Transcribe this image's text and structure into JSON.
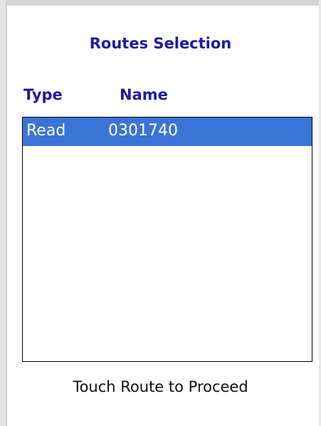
{
  "screen": {
    "title": "Routes Selection",
    "footer_text": "Touch Route to Proceed"
  },
  "routes_list": {
    "columns": [
      "Type",
      "Name"
    ],
    "rows": [
      {
        "type": "Read",
        "name": "0301740",
        "selected": true
      }
    ]
  },
  "colors": {
    "title_blue": "#1a1aa8",
    "selection_blue": "#3b74d7",
    "selection_text": "#ffffff"
  }
}
